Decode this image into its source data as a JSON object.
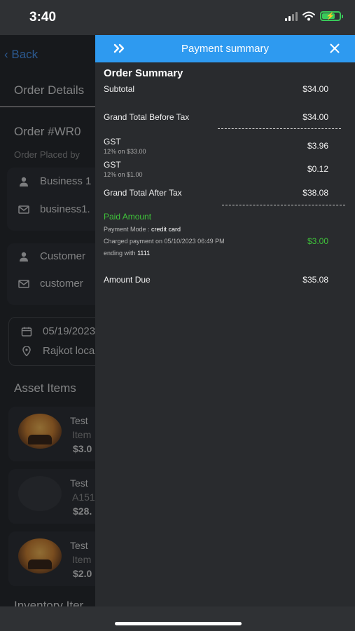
{
  "status_bar": {
    "time": "3:40"
  },
  "background_page": {
    "back_label": "Back",
    "tab_label": "Order Details",
    "order_number": "Order #WR0",
    "order_placed_label": "Order Placed by",
    "business_name": "Business 1",
    "business_email": "business1.",
    "customer_name": "Customer",
    "customer_email": "customer",
    "date": "05/19/2023",
    "location": "Rajkot loca",
    "asset_section_title": "Asset Items",
    "inventory_section_title": "Inventory Iter",
    "assets": [
      {
        "name": "Test",
        "sub": "Item",
        "price": "$3.0"
      },
      {
        "name": "Test",
        "sub": "A151",
        "price": "$28."
      },
      {
        "name": "Test",
        "sub": "Item",
        "price": "$2.0"
      }
    ]
  },
  "drawer": {
    "title": "Payment summary",
    "section_title": "Order Summary",
    "subtotal_label": "Subtotal",
    "subtotal_value": "$34.00",
    "before_tax_label": "Grand Total Before Tax",
    "before_tax_value": "$34.00",
    "taxes": [
      {
        "label": "GST",
        "sub": "12% on $33.00",
        "value": "$3.96"
      },
      {
        "label": "GST",
        "sub": "12% on $1.00",
        "value": "$0.12"
      }
    ],
    "after_tax_label": "Grand Total After Tax",
    "after_tax_value": "$38.08",
    "paid_label": "Paid Amount",
    "payment_mode_label": "Payment Mode :",
    "payment_mode_value": "credit card",
    "charged_text": "Charged payment on 05/10/2023 06:49 PM",
    "ending_label": "ending with",
    "ending_value": "1111",
    "paid_value": "$3.00",
    "amount_due_label": "Amount Due",
    "amount_due_value": "$35.08"
  },
  "colors": {
    "accent": "#2e9af0",
    "paid": "#3fc23a",
    "drawer_bg": "#292b2e",
    "battery": "#39c95a"
  },
  "icons": [
    "signal-icon",
    "wifi-icon",
    "battery-icon",
    "double-chevron-right-icon",
    "close-icon",
    "person-icon",
    "mail-icon",
    "calendar-icon",
    "location-pin-icon"
  ]
}
